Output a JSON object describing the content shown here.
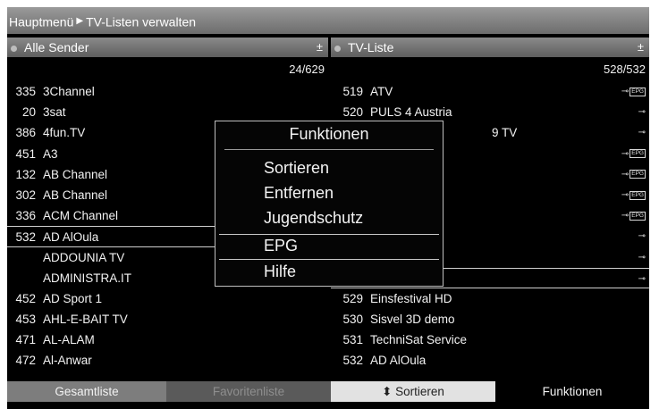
{
  "breadcrumb": {
    "parent": "Hauptmenü",
    "current": "TV-Listen verwalten"
  },
  "left_list": {
    "title": "Alle Sender",
    "count": "24/629",
    "rows": [
      {
        "num": "335",
        "name": "3Channel"
      },
      {
        "num": "20",
        "name": "3sat"
      },
      {
        "num": "386",
        "name": "4fun.TV"
      },
      {
        "num": "451",
        "name": "A3"
      },
      {
        "num": "132",
        "name": "AB Channel"
      },
      {
        "num": "302",
        "name": "AB Channel"
      },
      {
        "num": "336",
        "name": "ACM Channel"
      },
      {
        "num": "532",
        "name": "AD AlOula"
      },
      {
        "num": "",
        "name": "ADDOUNIA TV"
      },
      {
        "num": "",
        "name": "ADMINISTRA.IT"
      },
      {
        "num": "452",
        "name": "AD Sport 1"
      },
      {
        "num": "453",
        "name": "AHL-E-BAIT TV"
      },
      {
        "num": "471",
        "name": "AL-ALAM"
      },
      {
        "num": "472",
        "name": "Al-Anwar"
      }
    ]
  },
  "right_list": {
    "title": "TV-Liste",
    "count": "528/532",
    "rows": [
      {
        "num": "519",
        "name": "ATV"
      },
      {
        "num": "520",
        "name": "PULS 4 Austria"
      },
      {
        "num": "",
        "name": "9 TV"
      },
      {
        "num": "",
        "name": ""
      },
      {
        "num": "",
        "name": ""
      },
      {
        "num": "",
        "name": ""
      },
      {
        "num": "",
        "name": ""
      },
      {
        "num": "",
        "name": ""
      },
      {
        "num": "",
        "name": ""
      },
      {
        "num": "",
        "name": ""
      },
      {
        "num": "529",
        "name": "Einsfestival HD"
      },
      {
        "num": "530",
        "name": "Sisvel 3D demo"
      },
      {
        "num": "531",
        "name": "TechniSat Service"
      },
      {
        "num": "532",
        "name": "AD AlOula"
      }
    ],
    "icon_labels": {
      "box": "EPG"
    }
  },
  "popup": {
    "title": "Funktionen",
    "items": [
      "Sortieren",
      "Entfernen",
      "Jugendschutz",
      "EPG",
      "Hilfe"
    ]
  },
  "bottom_bar": {
    "red": "Gesamtliste",
    "green": "Favoritenliste",
    "yellow": "Sortieren",
    "blue": "Funktionen"
  },
  "sort_symbol": "±",
  "key_symbol": "⊸"
}
